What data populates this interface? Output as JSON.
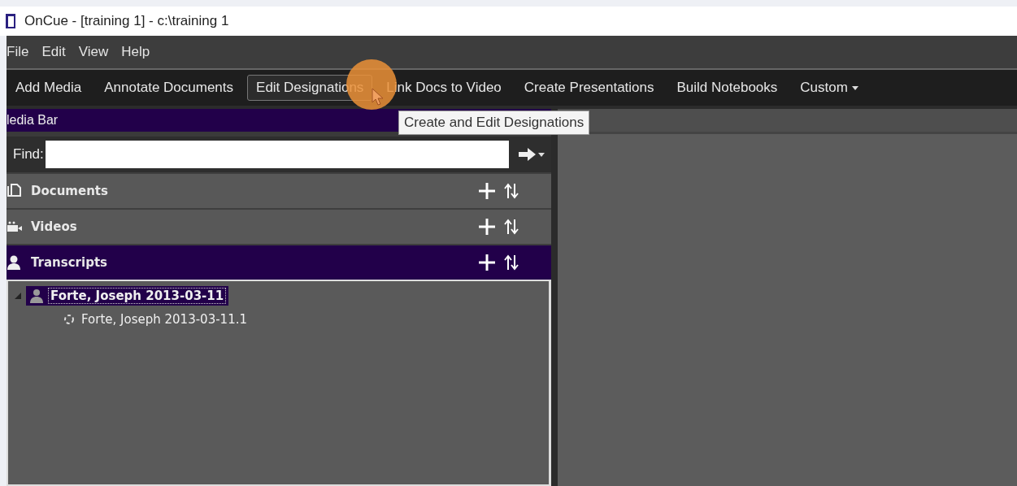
{
  "window": {
    "title": "OnCue - [training 1] - c:\\training 1"
  },
  "menu": [
    "File",
    "Edit",
    "View",
    "Help"
  ],
  "toolbar": [
    {
      "label": "Add Media",
      "selected": false
    },
    {
      "label": "Annotate Documents",
      "selected": false
    },
    {
      "label": "Edit Designations",
      "selected": true
    },
    {
      "label": "Link Docs to Video",
      "selected": false
    },
    {
      "label": "Create Presentations",
      "selected": false
    },
    {
      "label": "Build Notebooks",
      "selected": false
    },
    {
      "label": "Custom",
      "selected": false,
      "dropdown": true
    }
  ],
  "tooltip": "Create and Edit Designations",
  "media_bar": {
    "title": "ledia Bar",
    "find_label": "Find:",
    "sections": [
      {
        "kind": "documents",
        "label": "Documents",
        "selected": false
      },
      {
        "kind": "videos",
        "label": "Videos",
        "selected": false
      },
      {
        "kind": "transcripts",
        "label": "Transcripts",
        "selected": true
      }
    ],
    "tree": [
      {
        "label": "Forte, Joseph 2013-03-11",
        "selected": true,
        "expanded": true,
        "children": [
          {
            "label": "Forte, Joseph 2013-03-11.1",
            "selected": false
          }
        ]
      }
    ]
  }
}
